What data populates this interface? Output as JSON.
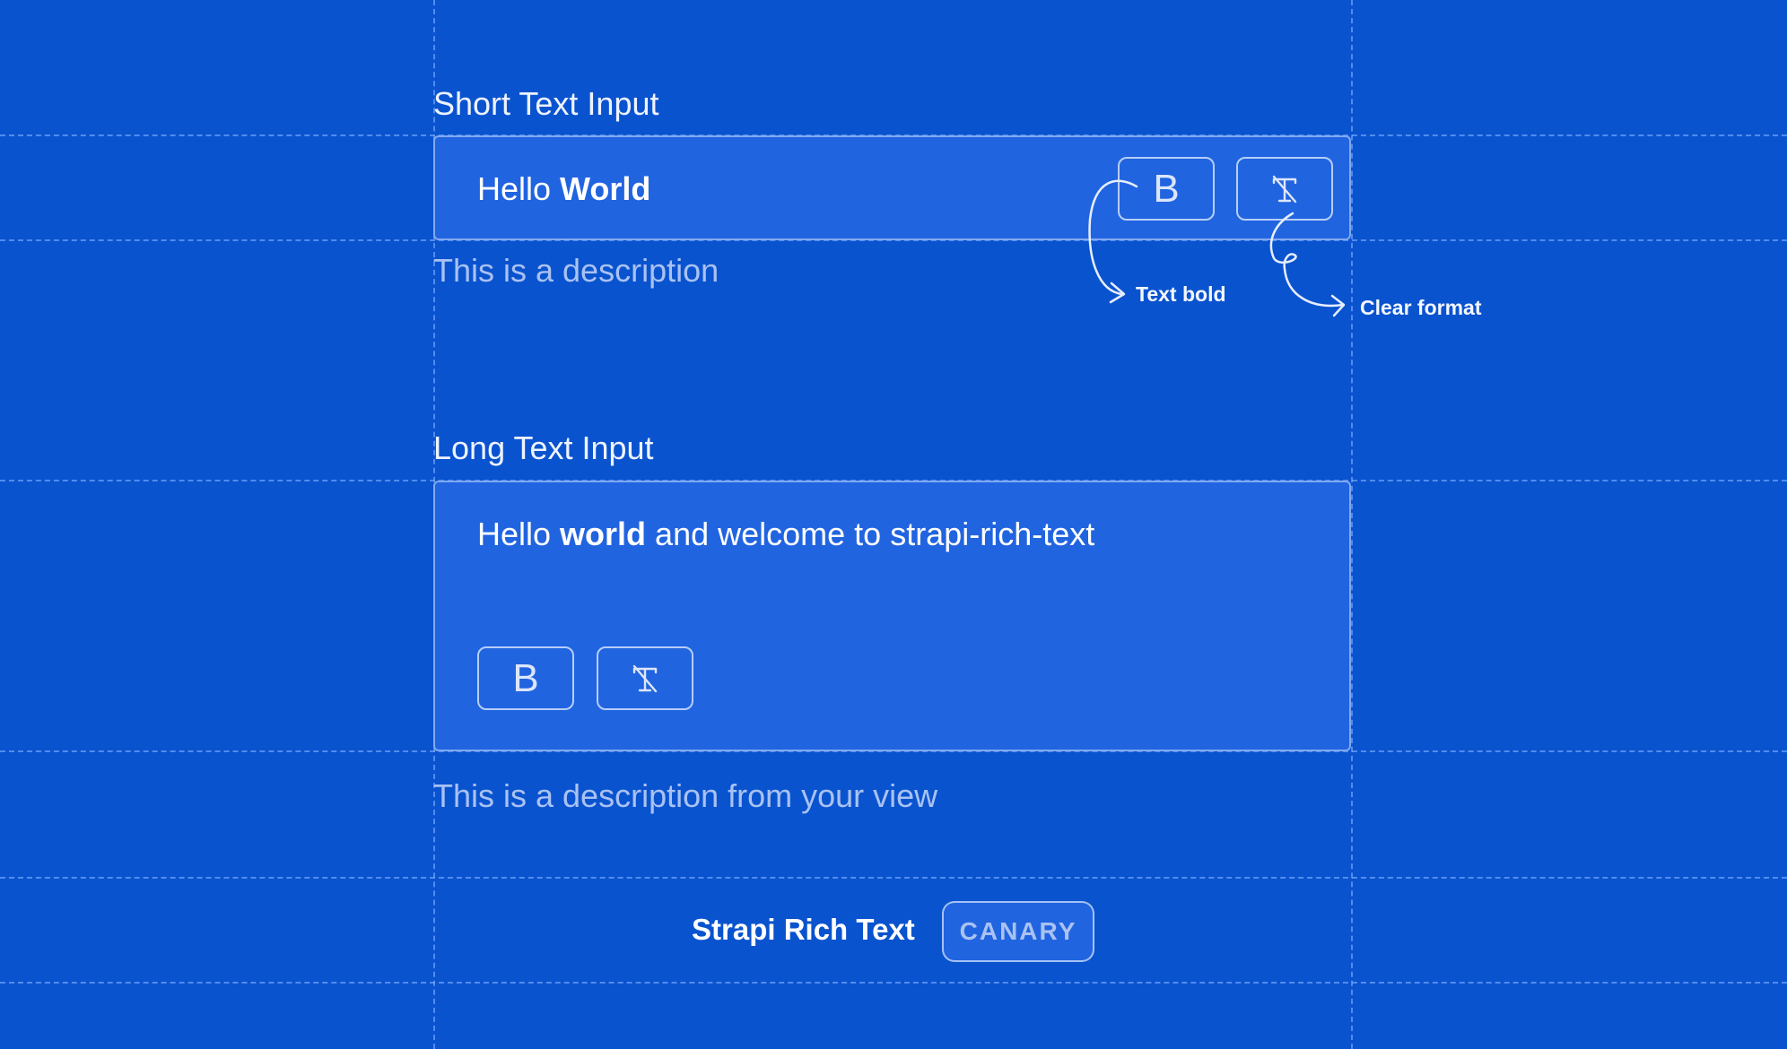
{
  "short_input": {
    "label": "Short Text Input",
    "text_plain": "Hello ",
    "text_bold": "World",
    "description": "This is a description",
    "bold_button_label": "B"
  },
  "long_input": {
    "label": "Long Text Input",
    "text_before": "Hello ",
    "text_bold": "world",
    "text_after": " and welcome to strapi-rich-text",
    "description": "This is a description from your view",
    "bold_button_label": "B"
  },
  "annotations": {
    "bold": "Text bold",
    "clear": "Clear format"
  },
  "footer": {
    "title": "Strapi Rich Text",
    "badge": "CANARY"
  },
  "icons": {
    "bold": "bold-icon",
    "clear_format": "clear-format-icon"
  },
  "colors": {
    "background": "#0A53CF",
    "field_background": "#2164E0",
    "description_text": "#A9C2F2"
  }
}
